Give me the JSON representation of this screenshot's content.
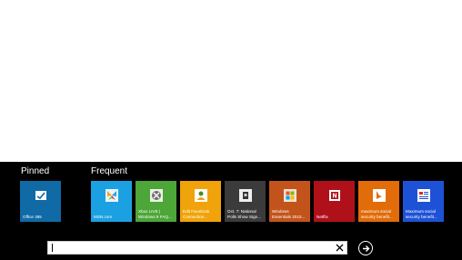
{
  "appbar": {
    "pinned_label": "Pinned",
    "frequent_label": "Frequent"
  },
  "pinned": [
    {
      "label": "Office 365",
      "color": "#0f6aa6",
      "icon": "office-365-icon"
    }
  ],
  "frequent": [
    {
      "label": "MSN.com",
      "color": "#1ba1e2",
      "icon": "msn-butterfly-icon"
    },
    {
      "label": "Xbox LIVE |\nWindows 8 FAQ...",
      "color": "#4ca638",
      "icon": "xbox-icon"
    },
    {
      "label": "Edit Facebook\nConnection...",
      "color": "#f0a30a",
      "icon": "windows-live-icon"
    },
    {
      "label": "Oct. 7: National\nPolls Show Sign...",
      "color": "#3b3b3b",
      "icon": "news-icon"
    },
    {
      "label": "Windows\nEssentials 2010...",
      "color": "#c2541b",
      "icon": "windows-logo-icon"
    },
    {
      "label": "Netflix",
      "color": "#b0101a",
      "icon": "netflix-icon"
    },
    {
      "label": "maximum social\nsecurity benefit...",
      "color": "#e26b0a",
      "icon": "bing-icon"
    },
    {
      "label": "Maximum social\nsecurity benefit...",
      "color": "#1e52d6",
      "icon": "document-icon"
    }
  ],
  "address": {
    "value": "",
    "placeholder": ""
  }
}
